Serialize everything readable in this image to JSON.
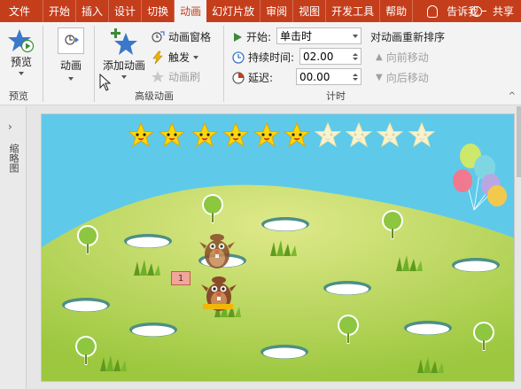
{
  "tabs": [
    "文件",
    "开始",
    "插入",
    "设计",
    "切换",
    "动画",
    "幻灯片放",
    "审阅",
    "视图",
    "开发工具",
    "帮助"
  ],
  "active_tab_index": 5,
  "tell_me": "告诉我",
  "share": "共享",
  "ribbon": {
    "preview": {
      "button": "预览",
      "group": "预览"
    },
    "animation": {
      "button": "动画"
    },
    "advanced": {
      "add_animation": "添加动画",
      "animation_pane": "动画窗格",
      "trigger": "触发",
      "animation_painter": "动画刷",
      "group": "高级动画"
    },
    "timing": {
      "start_label": "开始:",
      "start_value": "单击时",
      "duration_label": "持续时间:",
      "duration_value": "02.00",
      "delay_label": "延迟:",
      "delay_value": "00.00",
      "group": "计时"
    },
    "reorder": {
      "title": "对动画重新排序",
      "move_earlier": "向前移动",
      "move_later": "向后移动"
    }
  },
  "left_pane_label": "缩略图",
  "slide": {
    "stars_filled": 6,
    "stars_total": 10,
    "animation_tag": "1"
  }
}
